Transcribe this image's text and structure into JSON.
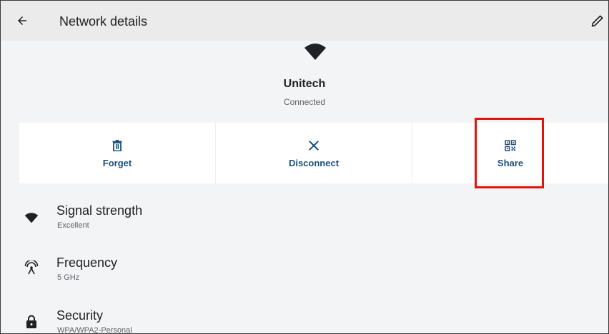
{
  "header": {
    "title": "Network details",
    "back_icon": "arrow-back-icon",
    "edit_icon": "pencil-icon"
  },
  "network": {
    "name": "Unitech",
    "status": "Connected",
    "icon": "wifi-icon"
  },
  "actions": [
    {
      "label": "Forget",
      "icon": "trash-icon"
    },
    {
      "label": "Disconnect",
      "icon": "close-icon"
    },
    {
      "label": "Share",
      "icon": "qr-code-icon"
    }
  ],
  "details": [
    {
      "title": "Signal strength",
      "value": "Excellent",
      "icon": "wifi-icon"
    },
    {
      "title": "Frequency",
      "value": "5 GHz",
      "icon": "antenna-icon"
    },
    {
      "title": "Security",
      "value": "WPA/WPA2-Personal",
      "icon": "lock-icon"
    }
  ],
  "colors": {
    "accent": "#1a4f7c",
    "highlight": "#e0140c",
    "background": "#f3f4f5"
  }
}
